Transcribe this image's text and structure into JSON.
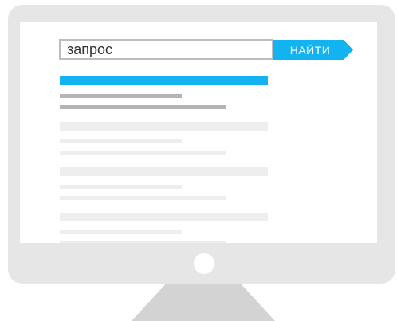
{
  "search": {
    "query": "запрос",
    "button_label": "НАЙТИ"
  },
  "colors": {
    "accent": "#12b3f0",
    "frame": "#e6e6e6",
    "stand": "#d3d3d3",
    "placeholder_dark": "#b4b4b4",
    "placeholder_light": "#eeeeee"
  }
}
